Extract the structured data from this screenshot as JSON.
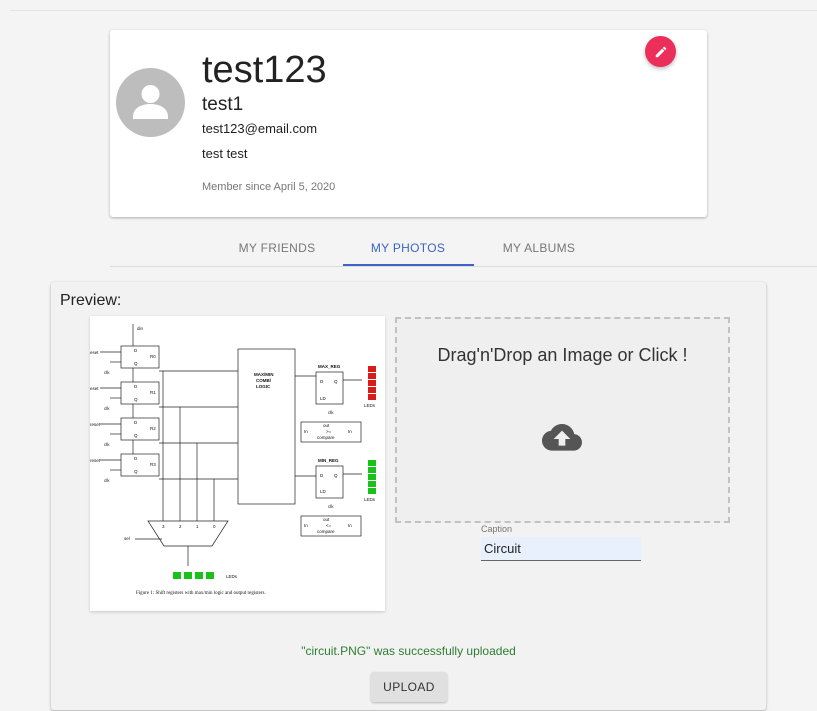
{
  "profile": {
    "username": "test123",
    "display_name": "test1",
    "email": "test123@email.com",
    "bio": "test test",
    "member_since": "Member since April 5, 2020",
    "avatar_icon": "person-icon",
    "edit_icon": "pencil-icon",
    "accent_color": "#ec2e5a"
  },
  "tabs": [
    {
      "label": "MY FRIENDS",
      "active": false
    },
    {
      "label": "MY PHOTOS",
      "active": true
    },
    {
      "label": "MY ALBUMS",
      "active": false
    }
  ],
  "tab_accent_color": "#3b64c4",
  "upload": {
    "preview_label": "Preview:",
    "dropzone_text": "Drag'n'Drop an Image or Click !",
    "dropzone_icon": "cloud-upload-icon",
    "caption_label": "Caption",
    "caption_value": "Circuit",
    "status_message": "\"circuit.PNG\" was successfully uploaded",
    "status_color": "#2e7d32",
    "upload_button": "UPLOAD"
  },
  "preview_image": {
    "labels": {
      "din": "din",
      "reset": "reset",
      "eset": "eset",
      "clk": "clk",
      "d": "D",
      "q": "Q",
      "r0": "R0",
      "r1": "R1",
      "r2": "R2",
      "r3": "R3",
      "maxmin": [
        "MAX/MIN",
        "COMB/",
        "LOGIC"
      ],
      "max_reg": "MAX_REG",
      "min_reg": "MIN_REG",
      "ld": "LD",
      "leds": "LEDs",
      "out": "out",
      "in": "In",
      "gte": ">=",
      "lte": "<=",
      "compare": "compare",
      "sel": "sel",
      "mux_inputs": [
        "3",
        "2",
        "1",
        "0"
      ],
      "caption": "Figure 1: Shift registers with max/min logic and output registers."
    }
  }
}
